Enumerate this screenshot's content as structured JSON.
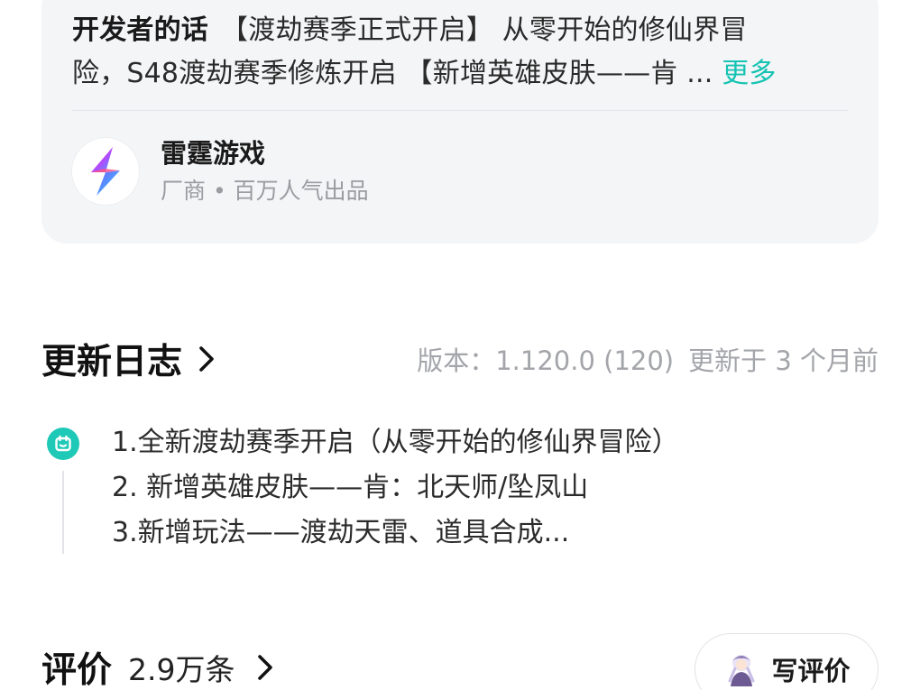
{
  "developer_note": {
    "title": "开发者的话",
    "line1": "【渡劫赛季正式开启】 从零开始的修仙界冒",
    "line2": "险，S48渡劫赛季修炼开启 【新增英雄皮肤——肯 ... ",
    "more_label": "更多"
  },
  "publisher": {
    "name": "雷霆游戏",
    "subtitle": "厂商 • 百万人气出品",
    "logo_icon": "lightning-bolt-icon"
  },
  "update_log": {
    "title": "更新日志",
    "version": "版本：1.120.0 (120)",
    "updated": "更新于 3 个月前",
    "lines": [
      "1.全新渡劫赛季开启（从零开始的修仙界冒险）",
      "2. 新增英雄皮肤——肯：北天师/坠凤山",
      "3.新增玩法——渡劫天雷、道具合成..."
    ]
  },
  "reviews": {
    "title": "评价",
    "count": "2.9万条",
    "write_label": "写评价"
  },
  "colors": {
    "accent": "#14c3b2",
    "card_bg": "#f4f5f7",
    "muted_text": "#a3a5aa"
  }
}
